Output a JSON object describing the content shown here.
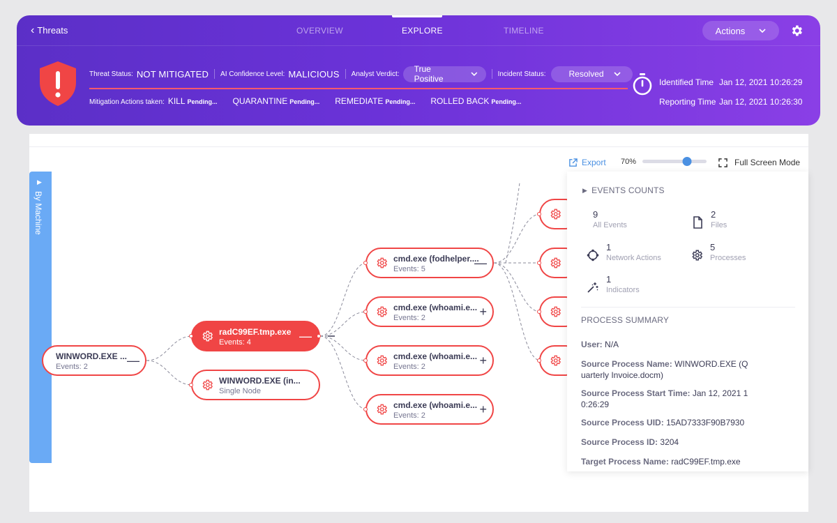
{
  "header": {
    "back_label": "Threats",
    "tabs": [
      {
        "label": "OVERVIEW",
        "active": false
      },
      {
        "label": "EXPLORE",
        "active": true
      },
      {
        "label": "TIMELINE",
        "active": false
      }
    ],
    "actions_label": "Actions",
    "threat_status_label": "Threat Status:",
    "threat_status_value": "NOT MITIGATED",
    "ai_confidence_label": "AI Confidence Level:",
    "ai_confidence_value": "MALICIOUS",
    "analyst_verdict_label": "Analyst Verdict:",
    "analyst_verdict_value": "True Positive",
    "incident_status_label": "Incident Status:",
    "incident_status_value": "Resolved",
    "mitigation_label": "Mitigation Actions taken:",
    "mitigation_actions": [
      {
        "name": "KILL",
        "status": "Pending..."
      },
      {
        "name": "QUARANTINE",
        "status": "Pending..."
      },
      {
        "name": "REMEDIATE",
        "status": "Pending..."
      },
      {
        "name": "ROLLED BACK",
        "status": "Pending..."
      }
    ],
    "identified_time_label": "Identified Time",
    "identified_time_value": "Jan 12, 2021 10:26:29",
    "reporting_time_label": "Reporting Time",
    "reporting_time_value": "Jan 12, 2021 10:26:30"
  },
  "toolbar": {
    "export_label": "Export",
    "zoom_label": "70%",
    "zoom_level": 0.7,
    "fullscreen_label": "Full Screen Mode"
  },
  "side_tab_label": "By Machine",
  "nodes": [
    {
      "title": "WINWORD.EXE ...",
      "sub": "Events: 2",
      "ctrl": "—"
    },
    {
      "title": "radC99EF.tmp.exe",
      "sub": "Events: 4",
      "ctrl": "—"
    },
    {
      "title": "WINWORD.EXE (in...",
      "sub": "Single Node",
      "ctrl": ""
    },
    {
      "title": "cmd.exe (fodhelper....",
      "sub": "Events: 5",
      "ctrl": "—"
    },
    {
      "title": "cmd.exe (whoami.e...",
      "sub": "Events: 2",
      "ctrl": "+"
    },
    {
      "title": "cmd.exe (whoami.e...",
      "sub": "Events: 2",
      "ctrl": "+"
    },
    {
      "title": "cmd.exe (whoami.e...",
      "sub": "Events: 2",
      "ctrl": "+"
    }
  ],
  "panel": {
    "events_heading": "EVENTS COUNTS",
    "stats": [
      {
        "count": "9",
        "label": "All Events",
        "icon": "all-events"
      },
      {
        "count": "2",
        "label": "Files",
        "icon": "file-icon"
      },
      {
        "count": "1",
        "label": "Network Actions",
        "icon": "network-icon"
      },
      {
        "count": "5",
        "label": "Processes",
        "icon": "gear-icon"
      },
      {
        "count": "1",
        "label": "Indicators",
        "icon": "sparkle-icon"
      }
    ],
    "summary_heading": "PROCESS SUMMARY",
    "summary": [
      {
        "key": "User:",
        "value": "N/A"
      },
      {
        "key": "Source Process Name:",
        "value": "WINWORD.EXE (Quarterly Invoice.docm)"
      },
      {
        "key": "Source Process Start Time:",
        "value": "Jan 12, 2021 10:26:29"
      },
      {
        "key": "Source Process UID:",
        "value": "15AD7333F90B7930"
      },
      {
        "key": "Source Process ID:",
        "value": "3204"
      },
      {
        "key": "Target Process Name:",
        "value": "radC99EF.tmp.exe"
      }
    ]
  },
  "colors": {
    "header_start": "#5b2fc7",
    "header_end": "#8a3fe6",
    "node_red": "#f04545",
    "accent_blue": "#4a90e2",
    "side_tab": "#6aaaf5"
  }
}
